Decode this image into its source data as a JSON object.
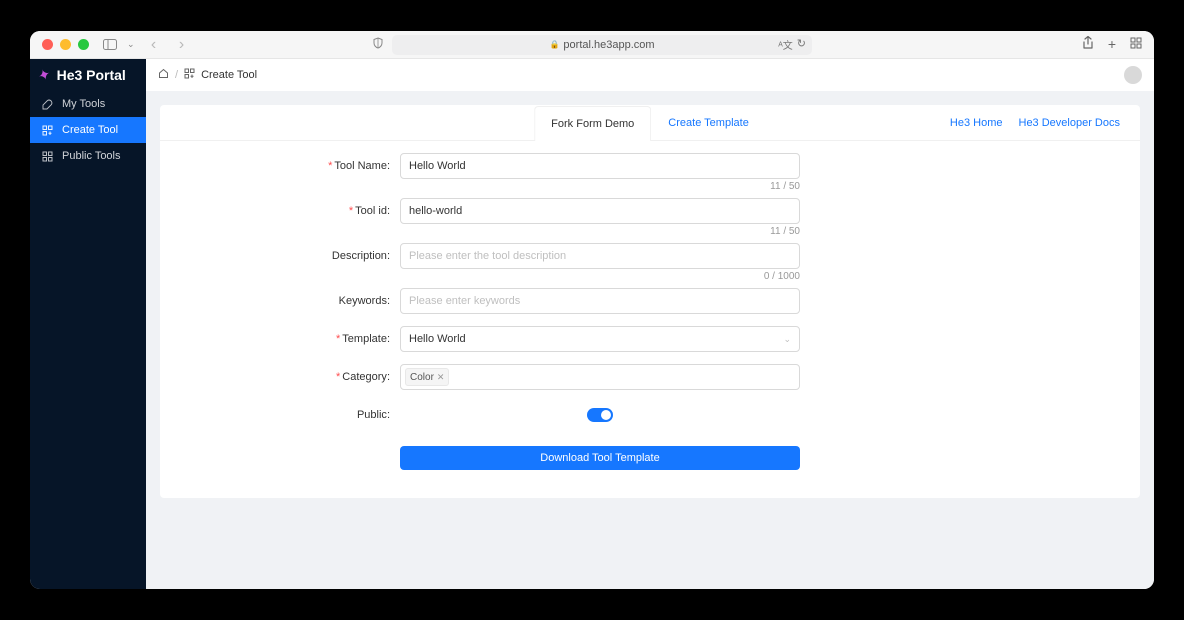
{
  "browser": {
    "url": "portal.he3app.com"
  },
  "sidebar": {
    "logo": "He3 Portal",
    "items": [
      {
        "icon": "tool",
        "label": "My Tools"
      },
      {
        "icon": "app",
        "label": "Create Tool"
      },
      {
        "icon": "grid",
        "label": "Public Tools"
      }
    ]
  },
  "breadcrumb": {
    "current": "Create Tool"
  },
  "tabs": {
    "left": "Fork Form Demo",
    "right": "Create Template"
  },
  "links": {
    "home": "He3 Home",
    "docs": "He3 Developer Docs"
  },
  "form": {
    "toolName": {
      "label": "Tool Name",
      "value": "Hello World",
      "counter": "11 / 50"
    },
    "toolId": {
      "label": "Tool id",
      "value": "hello-world",
      "counter": "11 / 50"
    },
    "description": {
      "label": "Description",
      "placeholder": "Please enter the tool description",
      "counter": "0 / 1000"
    },
    "keywords": {
      "label": "Keywords",
      "placeholder": "Please enter keywords"
    },
    "template": {
      "label": "Template",
      "value": "Hello World"
    },
    "category": {
      "label": "Category",
      "tag": "Color"
    },
    "public": {
      "label": "Public"
    },
    "submit": "Download Tool Template"
  }
}
